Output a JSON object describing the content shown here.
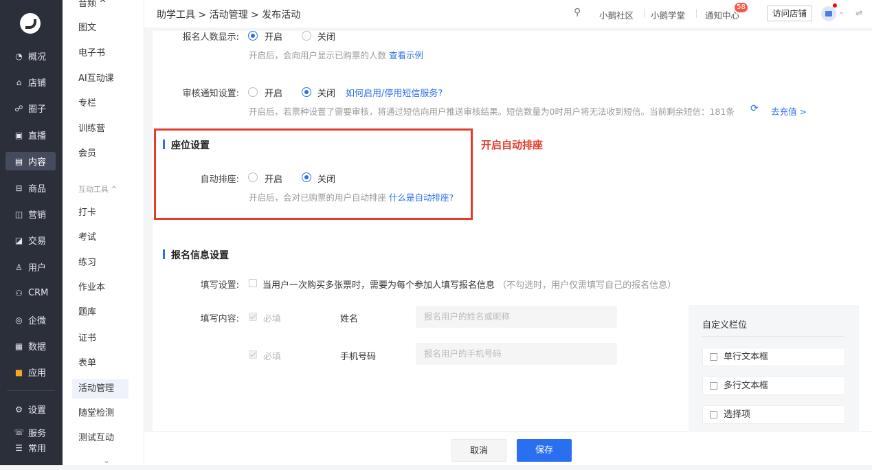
{
  "sidebar1": {
    "items": [
      {
        "icon": "◔",
        "label": "概况"
      },
      {
        "icon": "⌂",
        "label": "店铺"
      },
      {
        "icon": "☍",
        "label": "圈子"
      },
      {
        "icon": "▣",
        "label": "直播"
      },
      {
        "icon": "▤",
        "label": "内容"
      },
      {
        "icon": "⊟",
        "label": "商品"
      },
      {
        "icon": "◫",
        "label": "营销"
      },
      {
        "icon": "◪",
        "label": "交易"
      },
      {
        "icon": "♙",
        "label": "用户"
      },
      {
        "icon": "⚇",
        "label": "CRM"
      },
      {
        "icon": "◎",
        "label": "企微"
      },
      {
        "icon": "▦",
        "label": "数据"
      },
      {
        "icon": "■",
        "label": "应用"
      },
      {
        "icon": "⚙",
        "label": "设置"
      },
      {
        "icon": "☏",
        "label": "服务"
      },
      {
        "icon": "☰",
        "label": "常用"
      }
    ]
  },
  "sidebar2": {
    "top": "音频 ^",
    "items": [
      "图文",
      "电子书",
      "AI互动课",
      "专栏",
      "训练营",
      "会员"
    ],
    "group": "互动工具 ^",
    "tools": [
      "打卡",
      "考试",
      "练习",
      "作业本",
      "题库",
      "证书",
      "表单",
      "活动管理",
      "随堂检测",
      "测试互动"
    ],
    "more": "⌄"
  },
  "topbar": {
    "breadcrumb": "助学工具 > 活动管理 > 发布活动",
    "community": "小鹅社区",
    "school": "小鹅学堂",
    "notify": "通知中心",
    "notify_count": "58",
    "visit": "访问店铺"
  },
  "form": {
    "signup_count": {
      "label": "报名人数显示:",
      "on": "开启",
      "off": "关闭",
      "hint": "开启后，会向用户显示已购票的人数",
      "hint_link": "查看示例"
    },
    "audit_notice": {
      "label": "审核通知设置:",
      "on": "开启",
      "off": "关闭",
      "link": "如何启用/停用短信服务?",
      "hint": "开启后，若票种设置了需要审核，将通过短信向用户推送审核结果。短信数量为0时用户将无法收到短信。当前剩余短信：181条",
      "recharge": "去充值 >"
    },
    "seat": {
      "title": "座位设置",
      "label": "自动排座:",
      "on": "开启",
      "off": "关闭",
      "hint": "开启后，会对已购票的用户自动排座",
      "hint_link": "什么是自动排座?"
    },
    "annotation": "开启自动排座",
    "signup_info": {
      "title": "报名信息设置",
      "fill_label": "填写设置:",
      "fill_text": "当用户一次购买多张票时，需要为每个参加人填写报名信息",
      "fill_note": "（不勾选时，用户仅需填写自己的报名信息）",
      "content_label": "填写内容:",
      "required": "必填",
      "rows": [
        {
          "name": "姓名",
          "placeholder": "报名用户的姓名或昵称"
        },
        {
          "name": "手机号码",
          "placeholder": "报名用户的手机号码"
        }
      ]
    },
    "custom": {
      "title": "自定义栏位",
      "items": [
        "单行文本框",
        "多行文本框",
        "选择项"
      ]
    }
  },
  "footer": {
    "cancel": "取消",
    "save": "保存"
  }
}
